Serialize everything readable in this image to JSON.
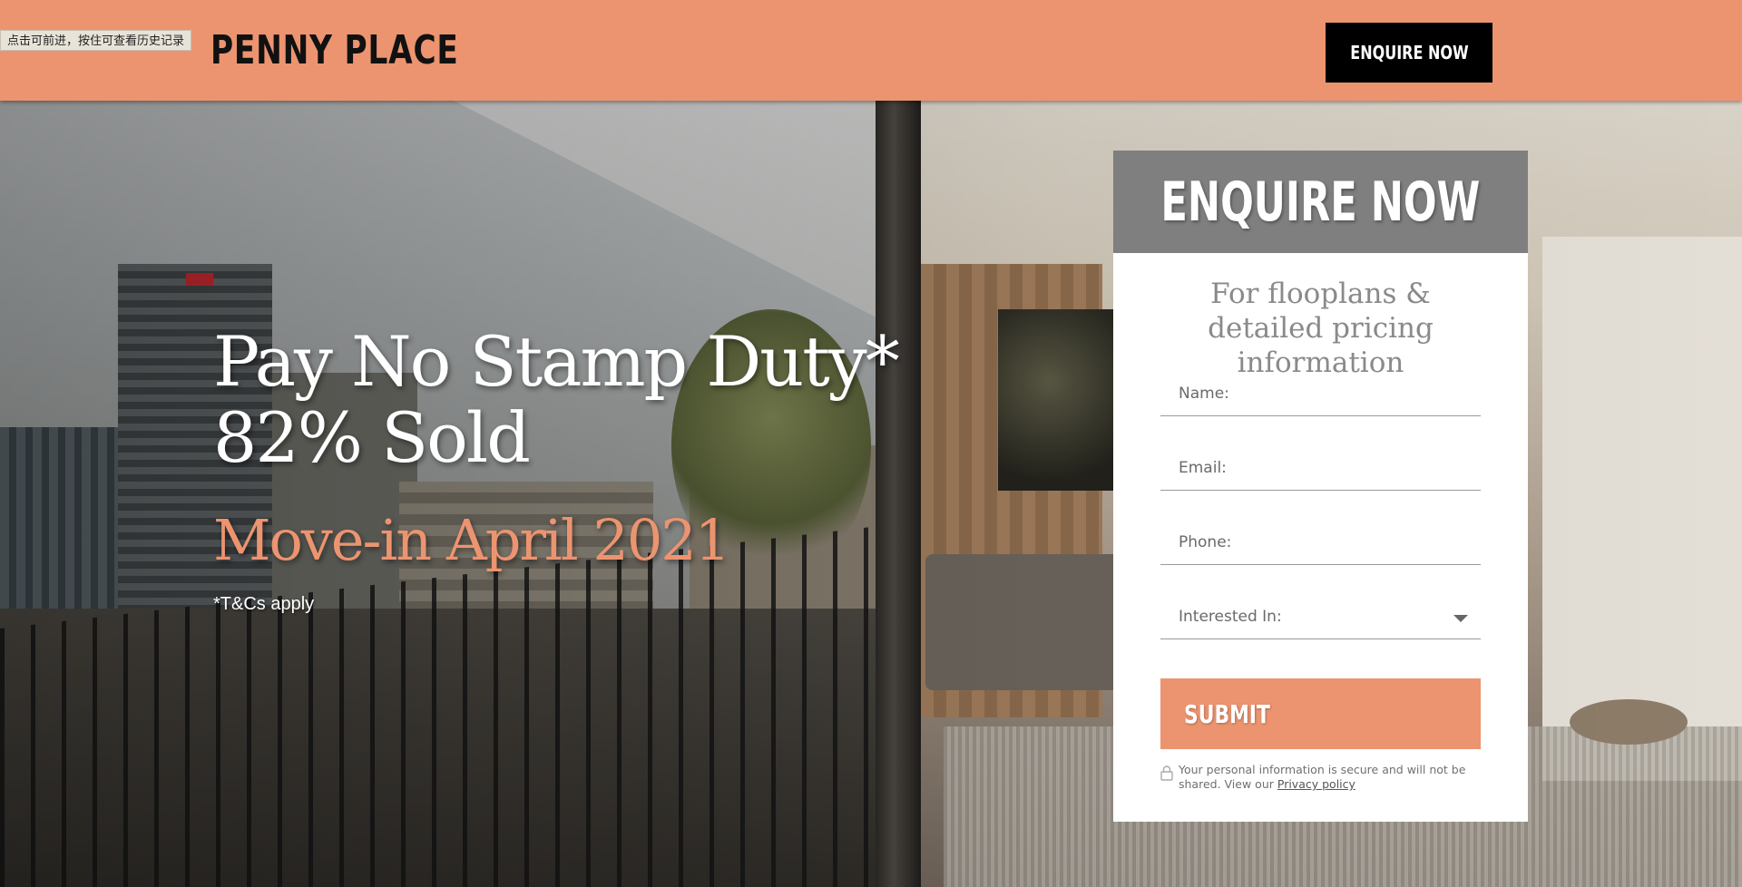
{
  "browser": {
    "history_tip": "点击可前进，按住可查看历史记录"
  },
  "header": {
    "brand": "PENNY PLACE",
    "cta_label": "ENQUIRE NOW",
    "background_color": "#ec9470"
  },
  "hero": {
    "headline_line1": "Pay No Stamp Duty*",
    "headline_line2": "82% Sold",
    "subline": "Move-in April 2021",
    "footnote": "*T&Cs apply",
    "accent_color": "#ec9470"
  },
  "enquiry_form": {
    "title": "ENQUIRE NOW",
    "subtitle": "For flooplans & detailed pricing information",
    "fields": {
      "name_placeholder": "Name:",
      "email_placeholder": "Email:",
      "phone_placeholder": "Phone:",
      "interest_label": "Interested In:"
    },
    "submit_label": "SUBMIT",
    "privacy_text": "Your personal information is secure and will not be shared. View our",
    "privacy_link": "Privacy policy",
    "header_color": "#7f7f7f"
  }
}
